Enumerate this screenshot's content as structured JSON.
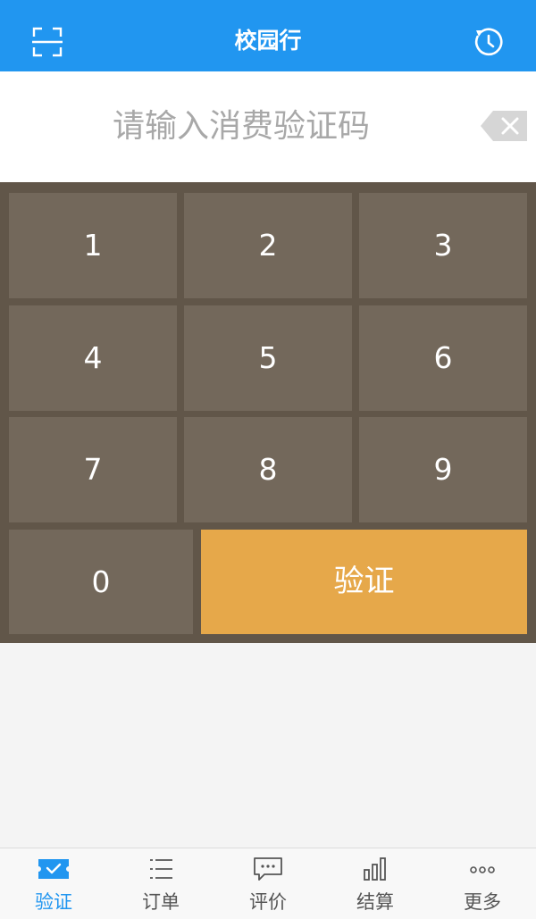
{
  "header": {
    "title": "校园行",
    "scan_icon": "scan-icon",
    "history_icon": "clock-history-icon"
  },
  "code_input": {
    "placeholder": "请输入消费验证码",
    "value": "",
    "backspace_icon": "backspace-icon"
  },
  "keypad": {
    "keys": [
      "1",
      "2",
      "3",
      "4",
      "5",
      "6",
      "7",
      "8",
      "9",
      "0"
    ],
    "verify_label": "验证"
  },
  "tabbar": {
    "active": 0,
    "tabs": [
      {
        "label": "验证",
        "icon": "ticket-check-icon"
      },
      {
        "label": "订单",
        "icon": "list-icon"
      },
      {
        "label": "评价",
        "icon": "comment-icon"
      },
      {
        "label": "结算",
        "icon": "bar-chart-icon"
      },
      {
        "label": "更多",
        "icon": "more-dots-icon"
      }
    ]
  },
  "colors": {
    "primary": "#2196f0",
    "keypad_bg": "#615649",
    "key_bg": "#73685b",
    "verify_bg": "#e6a84a"
  }
}
